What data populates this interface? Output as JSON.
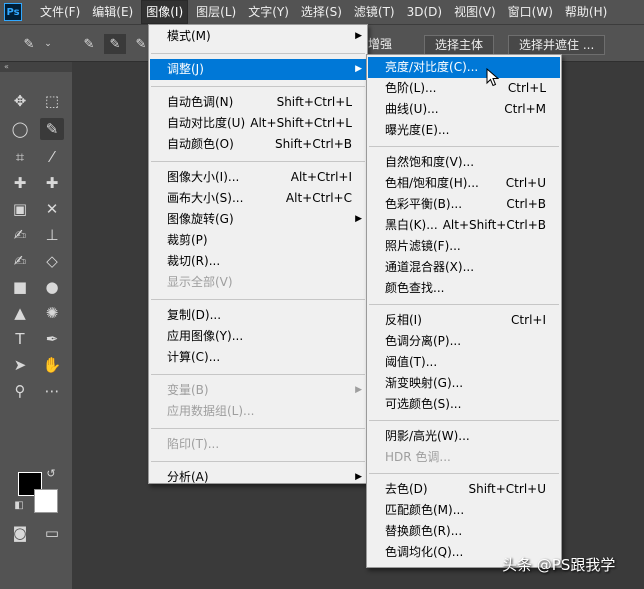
{
  "app": {
    "logo": "Ps"
  },
  "menubar": {
    "items": [
      "文件(F)",
      "编辑(E)",
      "图像(I)",
      "图层(L)",
      "文字(Y)",
      "选择(S)",
      "滤镜(T)",
      "3D(D)",
      "视图(V)",
      "窗口(W)",
      "帮助(H)"
    ],
    "active_index": 2
  },
  "options": {
    "partial_label": "增强",
    "select_subject": "选择主体",
    "select_and_mask": "选择并遮住 ..."
  },
  "image_menu": [
    {
      "label": "模式(M)",
      "shortcut": "",
      "submenu": true,
      "disabled": false
    },
    {
      "sep": true
    },
    {
      "label": "调整(J)",
      "shortcut": "",
      "submenu": true,
      "disabled": false,
      "highlight": true
    },
    {
      "sep": true
    },
    {
      "label": "自动色调(N)",
      "shortcut": "Shift+Ctrl+L",
      "submenu": false,
      "disabled": false
    },
    {
      "label": "自动对比度(U)",
      "shortcut": "Alt+Shift+Ctrl+L",
      "submenu": false,
      "disabled": false
    },
    {
      "label": "自动颜色(O)",
      "shortcut": "Shift+Ctrl+B",
      "submenu": false,
      "disabled": false
    },
    {
      "sep": true
    },
    {
      "label": "图像大小(I)...",
      "shortcut": "Alt+Ctrl+I",
      "submenu": false,
      "disabled": false
    },
    {
      "label": "画布大小(S)...",
      "shortcut": "Alt+Ctrl+C",
      "submenu": false,
      "disabled": false
    },
    {
      "label": "图像旋转(G)",
      "shortcut": "",
      "submenu": true,
      "disabled": false
    },
    {
      "label": "裁剪(P)",
      "shortcut": "",
      "submenu": false,
      "disabled": false
    },
    {
      "label": "裁切(R)...",
      "shortcut": "",
      "submenu": false,
      "disabled": false
    },
    {
      "label": "显示全部(V)",
      "shortcut": "",
      "submenu": false,
      "disabled": true
    },
    {
      "sep": true
    },
    {
      "label": "复制(D)...",
      "shortcut": "",
      "submenu": false,
      "disabled": false
    },
    {
      "label": "应用图像(Y)...",
      "shortcut": "",
      "submenu": false,
      "disabled": false
    },
    {
      "label": "计算(C)...",
      "shortcut": "",
      "submenu": false,
      "disabled": false
    },
    {
      "sep": true
    },
    {
      "label": "变量(B)",
      "shortcut": "",
      "submenu": true,
      "disabled": true
    },
    {
      "label": "应用数据组(L)...",
      "shortcut": "",
      "submenu": false,
      "disabled": true
    },
    {
      "sep": true
    },
    {
      "label": "陷印(T)...",
      "shortcut": "",
      "submenu": false,
      "disabled": true
    },
    {
      "sep": true
    },
    {
      "label": "分析(A)",
      "shortcut": "",
      "submenu": true,
      "disabled": false
    }
  ],
  "adjust_menu": [
    {
      "label": "亮度/对比度(C)...",
      "shortcut": "",
      "disabled": false,
      "highlight": true
    },
    {
      "label": "色阶(L)...",
      "shortcut": "Ctrl+L",
      "disabled": false
    },
    {
      "label": "曲线(U)...",
      "shortcut": "Ctrl+M",
      "disabled": false
    },
    {
      "label": "曝光度(E)...",
      "shortcut": "",
      "disabled": false
    },
    {
      "sep": true
    },
    {
      "label": "自然饱和度(V)...",
      "shortcut": "",
      "disabled": false
    },
    {
      "label": "色相/饱和度(H)...",
      "shortcut": "Ctrl+U",
      "disabled": false
    },
    {
      "label": "色彩平衡(B)...",
      "shortcut": "Ctrl+B",
      "disabled": false
    },
    {
      "label": "黑白(K)...",
      "shortcut": "Alt+Shift+Ctrl+B",
      "disabled": false
    },
    {
      "label": "照片滤镜(F)...",
      "shortcut": "",
      "disabled": false
    },
    {
      "label": "通道混合器(X)...",
      "shortcut": "",
      "disabled": false
    },
    {
      "label": "颜色查找...",
      "shortcut": "",
      "disabled": false
    },
    {
      "sep": true
    },
    {
      "label": "反相(I)",
      "shortcut": "Ctrl+I",
      "disabled": false
    },
    {
      "label": "色调分离(P)...",
      "shortcut": "",
      "disabled": false
    },
    {
      "label": "阈值(T)...",
      "shortcut": "",
      "disabled": false
    },
    {
      "label": "渐变映射(G)...",
      "shortcut": "",
      "disabled": false
    },
    {
      "label": "可选颜色(S)...",
      "shortcut": "",
      "disabled": false
    },
    {
      "sep": true
    },
    {
      "label": "阴影/高光(W)...",
      "shortcut": "",
      "disabled": false
    },
    {
      "label": "HDR 色调...",
      "shortcut": "",
      "disabled": true
    },
    {
      "sep": true
    },
    {
      "label": "去色(D)",
      "shortcut": "Shift+Ctrl+U",
      "disabled": false
    },
    {
      "label": "匹配颜色(M)...",
      "shortcut": "",
      "disabled": false
    },
    {
      "label": "替换颜色(R)...",
      "shortcut": "",
      "disabled": false
    },
    {
      "label": "色调均化(Q)...",
      "shortcut": "",
      "disabled": false
    }
  ],
  "watermark": "头条 @PS跟我学",
  "colors": {
    "highlight": "#0078d7",
    "menu_bg": "#f0f0f0",
    "chrome": "#535353",
    "canvas": "#3a3a3a"
  },
  "foreground_color": "#000000",
  "background_color": "#ffffff"
}
